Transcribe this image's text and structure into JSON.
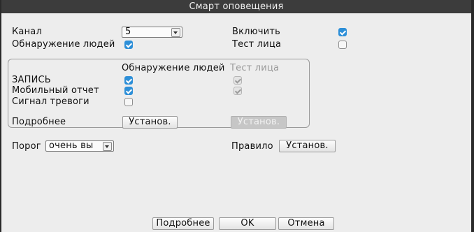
{
  "title": "Смарт оповещения",
  "channel": {
    "label": "Канал",
    "value": "5"
  },
  "enable": {
    "label": "Включить",
    "checked": true
  },
  "human_detection": {
    "label": "Обнаружение людей",
    "checked": true
  },
  "face_test": {
    "label": "Тест лица",
    "checked": false
  },
  "record_group": {
    "col_human": "Обнаружение людей",
    "col_face": "Тест лица",
    "rows": [
      {
        "label": "ЗАПИСЬ",
        "human": true,
        "face": true
      },
      {
        "label": "Мобильный отчет",
        "human": true,
        "face": true
      },
      {
        "label": "Сигнал тревоги",
        "human": false,
        "face": null
      }
    ],
    "details_label": "Подробнее",
    "setup_human": "Установ.",
    "setup_face": "Установ."
  },
  "threshold": {
    "label": "Порог",
    "value": "очень вы"
  },
  "rule": {
    "label": "Правило",
    "button": "Установ."
  },
  "footer": {
    "details": "Подробнее",
    "ok": "OK",
    "cancel": "Отмена"
  },
  "colors": {
    "titlebar": "#3c3c3c",
    "panel": "#ededed",
    "checked": "#2d8fd8"
  }
}
